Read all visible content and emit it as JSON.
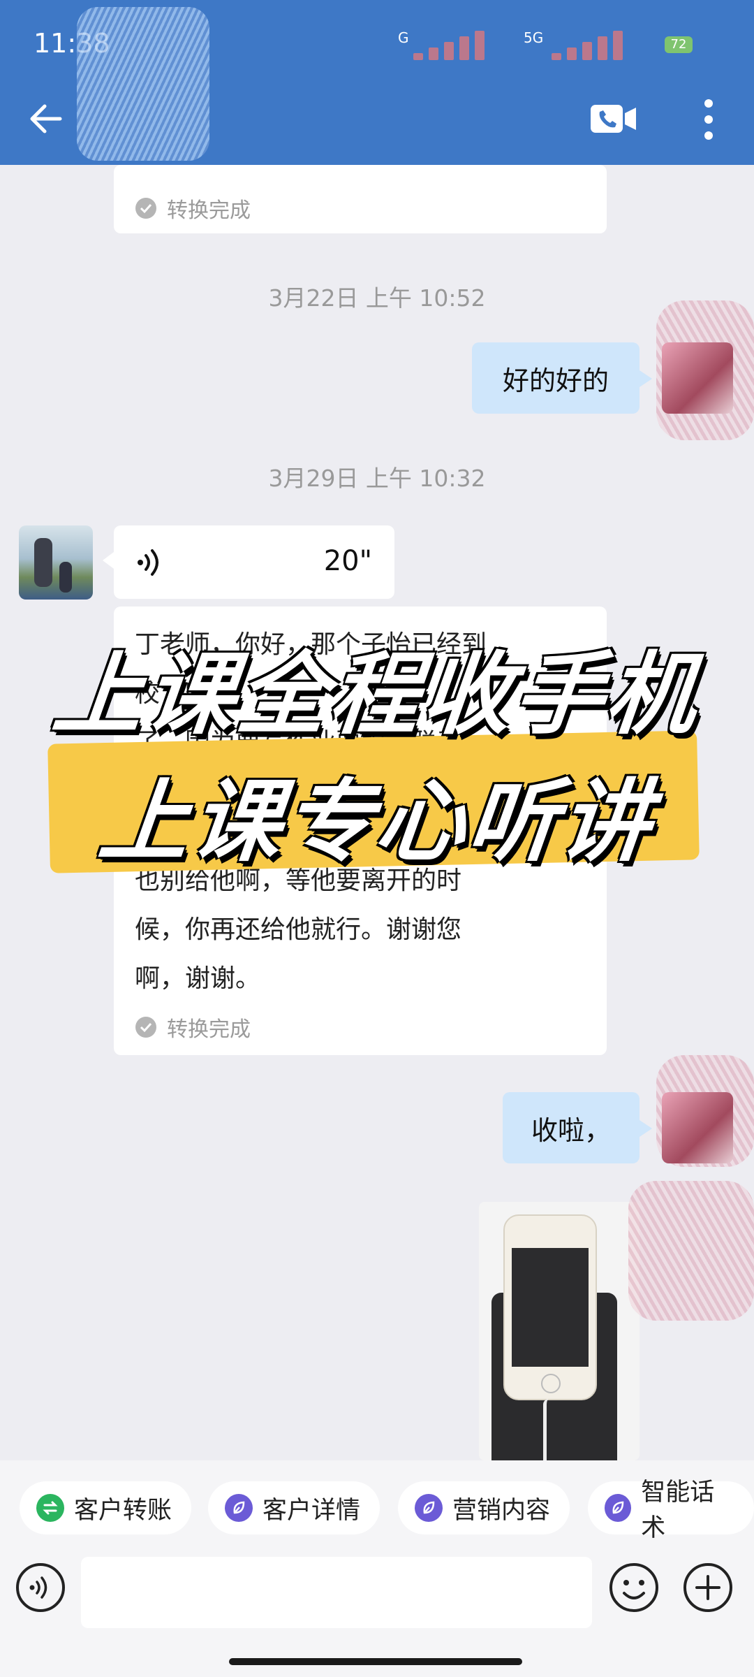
{
  "status_bar": {
    "time": "11:38",
    "network1": "G",
    "network2": "5G",
    "battery": "72"
  },
  "header": {
    "back_icon": "back-arrow-icon",
    "video_icon": "video-call-icon",
    "more_icon": "more-vert-icon"
  },
  "messages": {
    "prev_status": "转换完成",
    "time1": "3月22日  上午 10:52",
    "my_msg1": "好的好的",
    "time2": "3月29日  上午 10:32",
    "voice_duration": "20\"",
    "card_lines": [
      "丁老师，你好，那个子怡已经到",
      "校了吗？",
      "了，因为要写作业要跟我联系，",
      "也别给他啊，等他要离开的时",
      "候，你再还给他就行。谢谢您",
      "啊，谢谢。"
    ],
    "card_status": "转换完成",
    "my_msg2": "收啦，"
  },
  "overlay": {
    "line1": "上课全程收手机",
    "line2": "上课专心听讲"
  },
  "quick_actions": [
    {
      "label": "客户转账",
      "color": "#2bb55f"
    },
    {
      "label": "客户详情",
      "color": "#6b5bd6"
    },
    {
      "label": "营销内容",
      "color": "#6b5bd6"
    },
    {
      "label": "智能话术",
      "color": "#6b5bd6"
    }
  ],
  "input": {
    "placeholder": ""
  },
  "colors": {
    "header": "#3e78c6",
    "my_bubble": "#cfe6fb",
    "overlay_highlight": "#f7c948"
  }
}
